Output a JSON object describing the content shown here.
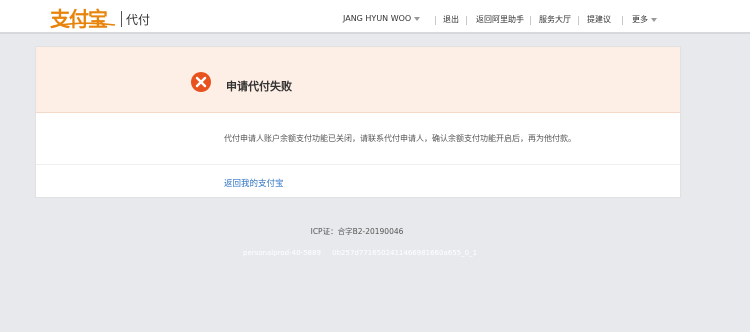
{
  "header": {
    "logo_text": "支付宝",
    "product_name": "代付",
    "user_name": "JANG HYUN WOO",
    "nav": {
      "logout": "退出",
      "back_helper": "返回阿里助手",
      "service_hall": "服务大厅",
      "suggest": "提建议",
      "more": "更多"
    }
  },
  "result": {
    "title": "申请代付失败",
    "message": "代付申请人账户余额支付功能已关闭，请联系代付申请人，确认余额支付功能开启后，再为他付款。",
    "back_link": "返回我的支付宝"
  },
  "footer": {
    "icp": "ICP证：合字B2-20190046",
    "server_id": "personalprod-40-5889",
    "trace_id": "0b257d7716502411466981660a655_0_1"
  },
  "colors": {
    "accent": "#e8840b",
    "error": "#e8521f",
    "link": "#2f74c7"
  }
}
